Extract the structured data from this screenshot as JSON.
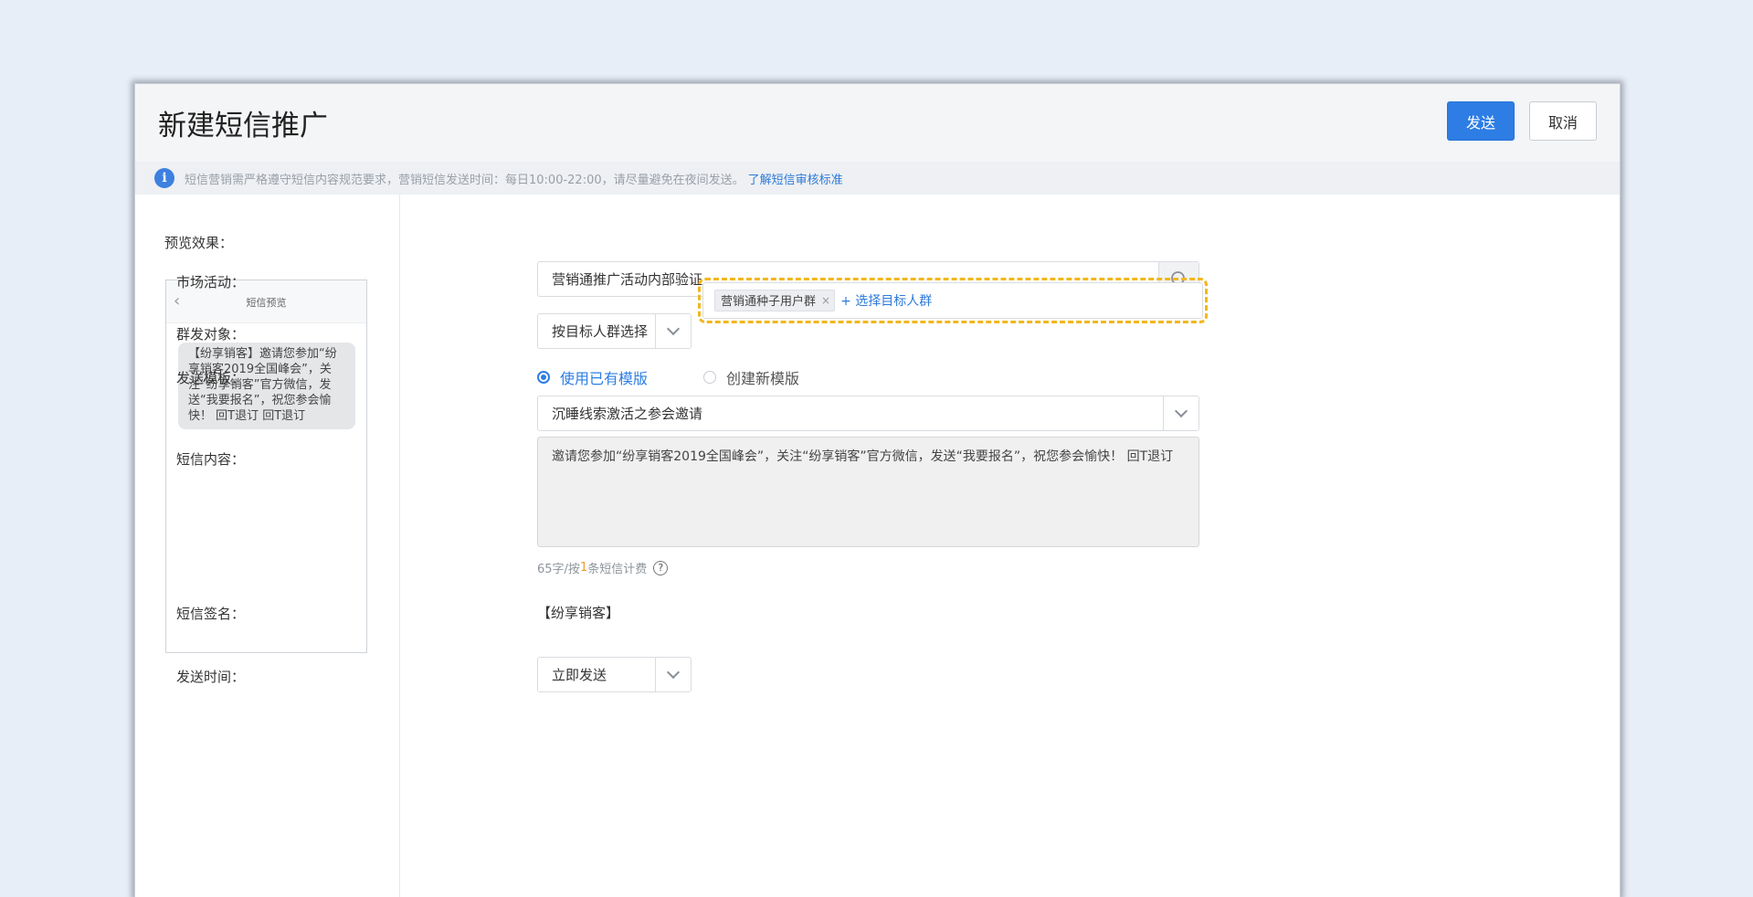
{
  "header": {
    "title": "新建短信推广",
    "send_label": "发送",
    "cancel_label": "取消"
  },
  "notice": {
    "icon": "info-icon",
    "text": "短信营销需严格遵守短信内容规范要求，营销短信发送时间：每日10:00-22:00，请尽量避免在夜间发送。",
    "link": "了解短信审核标准"
  },
  "preview": {
    "label": "预览效果：",
    "phone_title": "短信预览",
    "message": "【纷享销客】邀请您参加“纷享销客2019全国峰会”，关注“纷享销客”官方微信，发送“我要报名”，祝您参会愉快！ 回T退订 回T退订"
  },
  "form": {
    "campaign": {
      "label": "市场活动：",
      "value": "营销通推广活动内部验证"
    },
    "audience": {
      "label": "群发对象：",
      "mode": "按目标人群选择",
      "tag": "营销通种子用户群",
      "tag_remove": "×",
      "add_link": "+ 选择目标人群"
    },
    "template": {
      "label": "发送模板：",
      "option_existing": "使用已有模版",
      "option_new": "创建新模版",
      "selected": "沉睡线索激活之参会邀请"
    },
    "content": {
      "label": "短信内容：",
      "value": "邀请您参加“纷享销客2019全国峰会”，关注“纷享销客”官方微信，发送“我要报名”，祝您参会愉快！ 回T退订",
      "count_prefix": "65字/按 ",
      "count_num": "1",
      "count_suffix": "条短信计费",
      "help": "?"
    },
    "signature": {
      "label": "短信签名：",
      "value": "【纷享销客】"
    },
    "send_time": {
      "label": "发送时间：",
      "value": "立即发送"
    }
  },
  "colors": {
    "primary": "#2d7de4",
    "highlight_dashed": "#f2b71d",
    "count_accent": "#f29a2e"
  }
}
